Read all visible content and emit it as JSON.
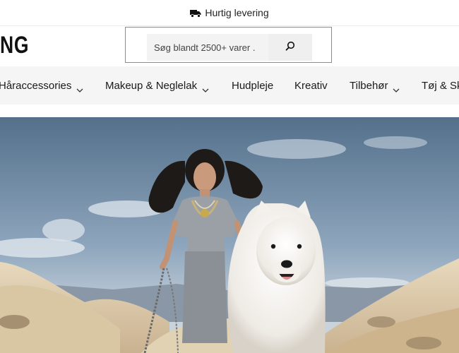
{
  "announcement": {
    "icon": "truck-icon",
    "text": "Hurtig levering"
  },
  "logo": {
    "text": "NG"
  },
  "search": {
    "placeholder": "Søg blandt 2500+ varer .",
    "icon": "search-icon"
  },
  "nav": {
    "items": [
      {
        "label": "Håraccessories",
        "has_dropdown": true
      },
      {
        "label": "Makeup & Neglelak",
        "has_dropdown": true
      },
      {
        "label": "Hudpleje",
        "has_dropdown": false
      },
      {
        "label": "Kreativ",
        "has_dropdown": false
      },
      {
        "label": "Tilbehør",
        "has_dropdown": true
      },
      {
        "label": "Tøj & Sk",
        "has_dropdown": false
      }
    ]
  },
  "hero": {
    "image": "girl-with-white-dog-in-desert"
  },
  "colors": {
    "nav_bg": "#f5f5f5",
    "search_border": "#8c8c8c",
    "text": "#1a1a1a"
  }
}
